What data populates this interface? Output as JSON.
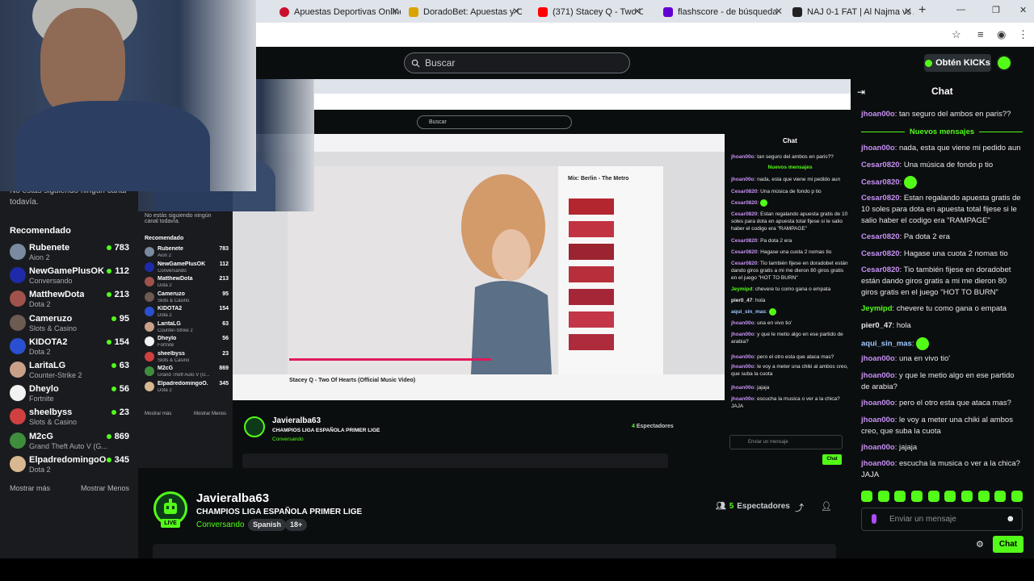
{
  "browser": {
    "tabs": [
      {
        "label": "Apuestas Deportivas Online | A",
        "color": "#c8102e"
      },
      {
        "label": "DoradoBet: Apuestas y Casino",
        "color": "#d9a300"
      },
      {
        "label": "(371) Stacey Q - Two Of He",
        "color": "#ff0000"
      },
      {
        "label": "flashscore - de búsqueda",
        "color": "#6001d2"
      },
      {
        "label": "NAJ 0-1 FAT | Al Najma vs Al Fa",
        "color": "#222222"
      }
    ]
  },
  "header": {
    "search_placeholder": "Buscar",
    "kicks_label": "Obtén KICKs"
  },
  "sidebar": {
    "offline_text": "No estás siguiendo ningún canal todavía.",
    "recommended_title": "Recomendado",
    "items": [
      {
        "name": "Rubenete",
        "game": "Aion 2",
        "viewers": "783",
        "color": "#7a8aa0"
      },
      {
        "name": "NewGamePlusOK",
        "game": "Conversando",
        "viewers": "112",
        "color": "#1e2aa8"
      },
      {
        "name": "MatthewDota",
        "game": "Dota 2",
        "viewers": "213",
        "color": "#a0524b"
      },
      {
        "name": "Cameruzo",
        "game": "Slots & Casino",
        "viewers": "95",
        "color": "#6d5a50"
      },
      {
        "name": "KIDOTA2",
        "game": "Dota 2",
        "viewers": "154",
        "color": "#2a4fd0"
      },
      {
        "name": "LaritaLG",
        "game": "Counter-Strike 2",
        "viewers": "63",
        "color": "#c9a08a"
      },
      {
        "name": "Dheylo",
        "game": "Fortnite",
        "viewers": "56",
        "color": "#f2f2f2"
      },
      {
        "name": "sheelbyss",
        "game": "Slots & Casino",
        "viewers": "23",
        "color": "#d04040"
      },
      {
        "name": "M2cG",
        "game": "Grand Theft Auto V (G...",
        "viewers": "869",
        "color": "#3e8e3e"
      },
      {
        "name": "ElpadredomingoO...",
        "game": "Dota 2",
        "viewers": "345",
        "color": "#d8b890"
      }
    ],
    "show_more": "Mostrar más",
    "show_less": "Mostrar Menos"
  },
  "stream": {
    "streamer": "Javieralba63",
    "title": "CHAMPIOS LIGA ESPAÑOLA PRIMER LIGE",
    "category": "Conversando",
    "tags": [
      "Spanish",
      "18+"
    ],
    "live_label": "LIVE",
    "viewers_count": "5",
    "viewers_label": "Espectadores"
  },
  "nested": {
    "video_title": "Stacey Q - Two Of Hearts (Official Music Video)",
    "side_title": "Mix: Berlin - The Metro",
    "viewers_count": "4"
  },
  "chat": {
    "title": "Chat",
    "new_messages_label": "Nuevos mensajes",
    "input_placeholder": "Enviar un mensaje",
    "send_label": "Chat",
    "messages": [
      {
        "user": "jhoan00o",
        "color": "#c891f5",
        "text": "tan seguro del ambos en paris??"
      },
      {
        "user": "jhoan00o",
        "color": "#c891f5",
        "text": "nada, esta que viene mi pedido aun"
      },
      {
        "user": "Cesar0820",
        "color": "#c891f5",
        "text": "Una música de fondo p tio"
      },
      {
        "user": "Cesar0820",
        "color": "#c891f5",
        "text": ""
      },
      {
        "user": "Cesar0820",
        "color": "#c891f5",
        "text": "Estan regalando apuesta gratis de 10 soles para dota en apuesta total fijese si le salio haber el codigo era \"RAMPAGE\""
      },
      {
        "user": "Cesar0820",
        "color": "#c891f5",
        "text": "Pa dota 2 era"
      },
      {
        "user": "Cesar0820",
        "color": "#c891f5",
        "text": "Hagase una cuota 2 nomas tio"
      },
      {
        "user": "Cesar0820",
        "color": "#c891f5",
        "text": "Tio también fijese en doradobet están dando giros gratis a mi me dieron 80 giros gratis en el juego \"HOT TO BURN\""
      },
      {
        "user": "Jeymipd",
        "color": "#53fc18",
        "text": "chevere tu como gana o empata"
      },
      {
        "user": "pier0_47",
        "color": "#e8e8e8",
        "text": "hola"
      },
      {
        "user": "aqui_sin_mas",
        "color": "#9ec9ff",
        "text": ""
      },
      {
        "user": "jhoan00o",
        "color": "#c891f5",
        "text": "una en vivo tio'"
      },
      {
        "user": "jhoan00o",
        "color": "#c891f5",
        "text": "y que le metio algo en ese partido de arabia?"
      },
      {
        "user": "jhoan00o",
        "color": "#c891f5",
        "text": "pero el otro esta que ataca mas?"
      },
      {
        "user": "jhoan00o",
        "color": "#c891f5",
        "text": "le voy a meter una chiki al ambos creo, que suba la cuota"
      },
      {
        "user": "jhoan00o",
        "color": "#c891f5",
        "text": "jajaja"
      },
      {
        "user": "jhoan00o",
        "color": "#c891f5",
        "text": "escucha la musica o ver a la chica? JAJA"
      }
    ]
  },
  "accent": "#53fc18"
}
